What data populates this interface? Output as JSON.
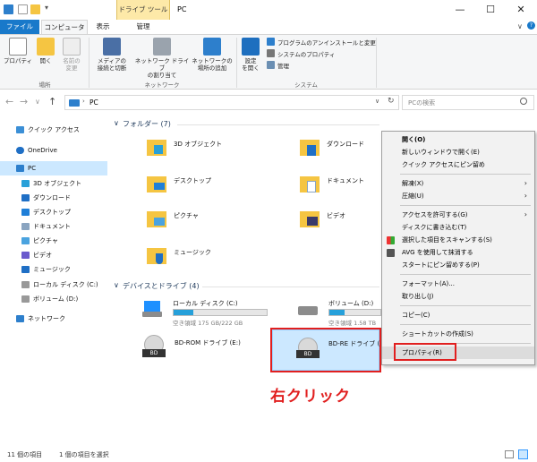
{
  "window": {
    "title": "PC",
    "tool_context_label": "ドライブ ツール",
    "controls": [
      "—",
      "☐",
      "✕"
    ]
  },
  "tabs": {
    "file": "ファイル",
    "computer": "コンピューター",
    "view": "表示",
    "manage": "管理"
  },
  "ribbon": {
    "location": {
      "properties": "プロパティ",
      "open": "開く",
      "rename_line1": "名前の",
      "rename_line2": "変更",
      "label": "場所"
    },
    "network": {
      "media_line1": "メディアの",
      "media_line2": "接続と切断",
      "map_line1": "ネットワーク ドライブ",
      "map_line2": "の割り当て",
      "add_line1": "ネットワークの",
      "add_line2": "場所の追加",
      "label": "ネットワーク"
    },
    "system": {
      "settings_line1": "設定",
      "settings_line2": "を開く",
      "uninstall": "プログラムのアンインストールと変更",
      "sys_props": "システムのプロパティ",
      "manage": "管理",
      "label": "システム"
    }
  },
  "address": {
    "path": "PC",
    "search_placeholder": "PCの検索",
    "nav": [
      "←",
      "→",
      "∨",
      "↑"
    ]
  },
  "nav_pane": [
    {
      "label": "クイック アクセス",
      "color": "#3b8fd6"
    },
    {
      "label": "OneDrive",
      "color": "#1f6fc5"
    },
    {
      "label": "PC",
      "color": "#2d7fcc",
      "selected": true
    },
    {
      "label": "3D オブジェクト",
      "color": "#29a0d8"
    },
    {
      "label": "ダウンロード",
      "color": "#1f6fc5"
    },
    {
      "label": "デスクトップ",
      "color": "#1f7fd8"
    },
    {
      "label": "ドキュメント",
      "color": "#8aa4c0"
    },
    {
      "label": "ピクチャ",
      "color": "#4aa3df"
    },
    {
      "label": "ビデオ",
      "color": "#6a5acd"
    },
    {
      "label": "ミュージック",
      "color": "#1f6fc5"
    },
    {
      "label": "ローカル ディスク (C:)",
      "color": "#999999"
    },
    {
      "label": "ボリューム (D:)",
      "color": "#999999"
    },
    {
      "label": "ネットワーク",
      "color": "#2d7fcc"
    }
  ],
  "folders": {
    "header": "フォルダー (7)",
    "items": [
      "3D オブジェクト",
      "ダウンロード",
      "デスクトップ",
      "ドキュメント",
      "ピクチャ",
      "ビデオ",
      "ミュージック"
    ]
  },
  "drives": {
    "header": "デバイスとドライブ (4)",
    "c_name": "ローカル ディスク (C:)",
    "c_free": "空き領域 175 GB/222 GB",
    "c_used_fraction": 0.21,
    "d_name": "ボリューム (D:)",
    "d_free": "空き領域 1.58 TB",
    "d_used_fraction": 0.3,
    "e_name": "BD-ROM ドライブ (E:)",
    "f_name": "BD-RE ドライブ (F",
    "bd_label": "BD"
  },
  "context_menu": {
    "open": "開く(O)",
    "open_new": "新しいウィンドウで開く(E)",
    "pin_quick": "クイック アクセスにピン留め",
    "unpack": "解凍(X)",
    "compress": "圧縮(U)",
    "give_access": "アクセスを許可する(G)",
    "burn": "ディスクに書き込む(T)",
    "scan": "選択した項目をスキャンする(S)",
    "avg": "AVG を使用して抹消する",
    "pin_start": "スタートにピン留めする(P)",
    "format": "フォーマット(A)...",
    "eject": "取り出し(J)",
    "copy": "コピー(C)",
    "shortcut": "ショートカットの作成(S)",
    "properties": "プロパティ(R)"
  },
  "annotation": "右クリック",
  "status": {
    "count": "11 個の項目",
    "selected": "1 個の項目を選択"
  },
  "colors": {
    "accent": "#1979ca",
    "highlight_red": "#e11f1f",
    "selection": "#cce8ff",
    "folder": "#f5c542"
  }
}
